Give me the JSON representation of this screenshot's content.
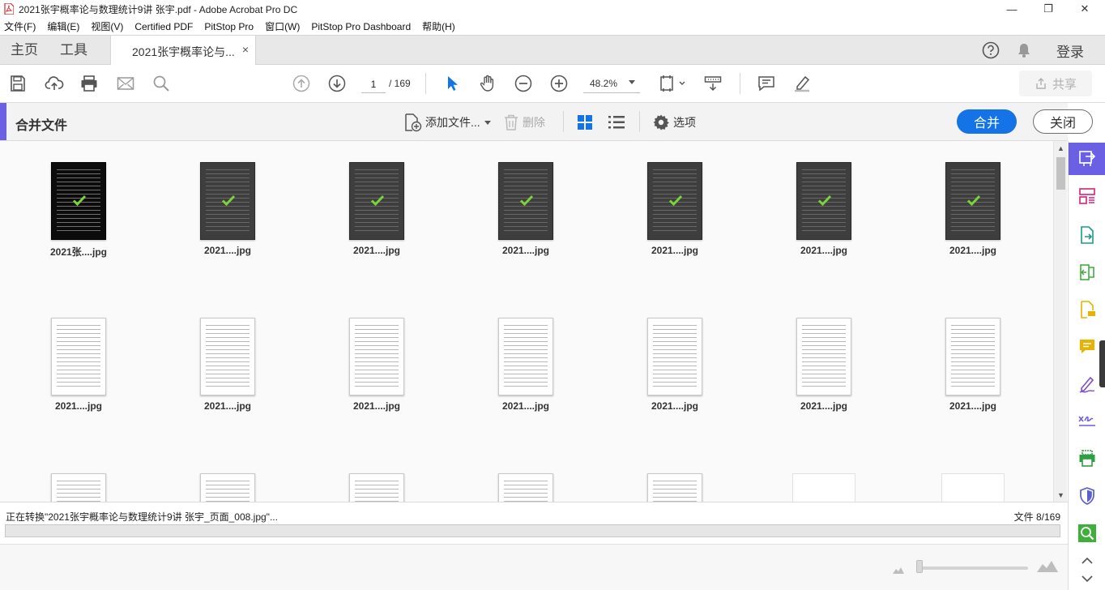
{
  "window": {
    "title": "2021张宇概率论与数理统计9讲 张宇.pdf - Adobe Acrobat Pro DC",
    "minimize_label": "—",
    "maximize_label": "❐",
    "close_label": "✕"
  },
  "menu": [
    "文件(F)",
    "编辑(E)",
    "视图(V)",
    "Certified PDF",
    "PitStop Pro",
    "窗口(W)",
    "PitStop Pro Dashboard",
    "帮助(H)"
  ],
  "tabs": {
    "home": "主页",
    "tools": "工具",
    "document": "2021张宇概率论与...",
    "close": "×",
    "signin": "登录"
  },
  "toolbar": {
    "page_current": "1",
    "page_total": "/ 169",
    "zoom": "48.2%",
    "share": "共享"
  },
  "combine": {
    "title": "合并文件",
    "add_files": "添加文件...",
    "delete": "删除",
    "options": "选项",
    "merge": "合并",
    "close": "关闭"
  },
  "files": [
    {
      "name": "2021张....jpg",
      "style": "black",
      "checked": true
    },
    {
      "name": "2021....jpg",
      "style": "dark",
      "checked": true
    },
    {
      "name": "2021....jpg",
      "style": "dark",
      "checked": true
    },
    {
      "name": "2021....jpg",
      "style": "dark",
      "checked": true
    },
    {
      "name": "2021....jpg",
      "style": "dark",
      "checked": true
    },
    {
      "name": "2021....jpg",
      "style": "dark",
      "checked": true
    },
    {
      "name": "2021....jpg",
      "style": "dark",
      "checked": true
    },
    {
      "name": "2021....jpg",
      "style": "page",
      "checked": false
    },
    {
      "name": "2021....jpg",
      "style": "page",
      "checked": false
    },
    {
      "name": "2021....jpg",
      "style": "page",
      "checked": false
    },
    {
      "name": "2021....jpg",
      "style": "page",
      "checked": false
    },
    {
      "name": "2021....jpg",
      "style": "page",
      "checked": false
    },
    {
      "name": "2021....jpg",
      "style": "page",
      "checked": false
    },
    {
      "name": "2021....jpg",
      "style": "page",
      "checked": false
    },
    {
      "name": "",
      "style": "page",
      "checked": false
    },
    {
      "name": "",
      "style": "page",
      "checked": false
    },
    {
      "name": "",
      "style": "page",
      "checked": false
    },
    {
      "name": "",
      "style": "page",
      "checked": false
    },
    {
      "name": "",
      "style": "page",
      "checked": false
    },
    {
      "name": "",
      "style": "blank",
      "checked": false
    },
    {
      "name": "",
      "style": "blank",
      "checked": false
    }
  ],
  "status": {
    "text": "正在转换\"2021张宇概率论与数理统计9讲 张宇_页面_008.jpg\"...",
    "count": "文件 8/169",
    "progress": 0.0
  },
  "colors": {
    "accent": "#6b5fe3",
    "primary_button": "#1473e6",
    "check": "#7fd13b"
  },
  "icons": {
    "right_panel": [
      "export-pdf-icon",
      "organize-pages-icon",
      "create-pdf-icon",
      "edit-pdf-icon",
      "comment-file-icon",
      "comment-icon",
      "fill-sign-icon",
      "send-for-signature-icon",
      "print-production-icon",
      "protect-icon",
      "enhance-scans-icon"
    ]
  }
}
